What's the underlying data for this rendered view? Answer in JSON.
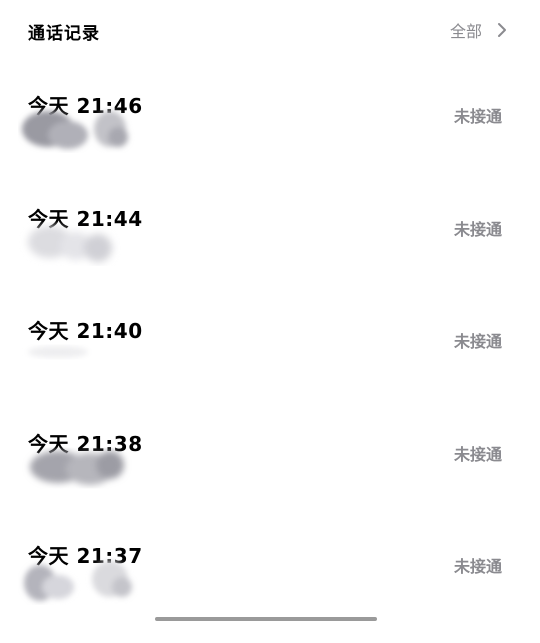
{
  "header": {
    "title": "通话记录",
    "all_label": "全部"
  },
  "calls": [
    {
      "time": "今天 21:46",
      "status": "未接通"
    },
    {
      "time": "今天 21:44",
      "status": "未接通"
    },
    {
      "time": "今天 21:40",
      "status": "未接通"
    },
    {
      "time": "今天 21:38",
      "status": "未接通"
    },
    {
      "time": "今天 21:37",
      "status": "未接通"
    }
  ],
  "icons": {
    "all_chevron": "chevron-right-icon"
  },
  "colors": {
    "secondary_text": "#8a8a8f",
    "redaction": "#a8a8b0"
  }
}
